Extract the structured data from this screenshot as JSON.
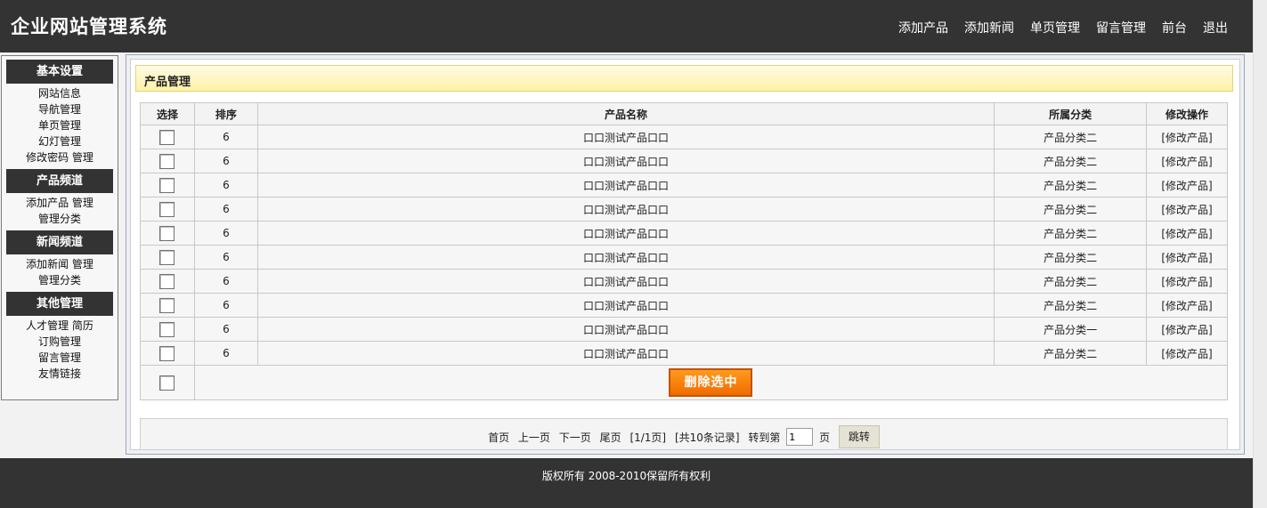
{
  "header": {
    "title": "企业网站管理系统",
    "nav": [
      "添加产品",
      "添加新闻",
      "单页管理",
      "留言管理",
      "前台",
      "退出"
    ]
  },
  "sidebar": {
    "sections": [
      {
        "heading": "基本设置",
        "items": [
          "网站信息",
          "导航管理",
          "单页管理",
          "幻灯管理",
          "修改密码 管理"
        ]
      },
      {
        "heading": "产品频道",
        "items": [
          "添加产品 管理",
          "管理分类"
        ]
      },
      {
        "heading": "新闻频道",
        "items": [
          "添加新闻 管理",
          "管理分类"
        ]
      },
      {
        "heading": "其他管理",
        "items": [
          "人才管理 简历",
          "订购管理",
          "留言管理",
          "友情链接"
        ]
      }
    ]
  },
  "main": {
    "title": "产品管理",
    "columns": [
      "选择",
      "排序",
      "产品名称",
      "所属分类",
      "修改操作"
    ],
    "rows": [
      {
        "order": "6",
        "name": "口口测试产品口口",
        "category": "产品分类二",
        "action": "[修改产品]"
      },
      {
        "order": "6",
        "name": "口口测试产品口口",
        "category": "产品分类二",
        "action": "[修改产品]"
      },
      {
        "order": "6",
        "name": "口口测试产品口口",
        "category": "产品分类二",
        "action": "[修改产品]"
      },
      {
        "order": "6",
        "name": "口口测试产品口口",
        "category": "产品分类二",
        "action": "[修改产品]"
      },
      {
        "order": "6",
        "name": "口口测试产品口口",
        "category": "产品分类二",
        "action": "[修改产品]"
      },
      {
        "order": "6",
        "name": "口口测试产品口口",
        "category": "产品分类二",
        "action": "[修改产品]"
      },
      {
        "order": "6",
        "name": "口口测试产品口口",
        "category": "产品分类二",
        "action": "[修改产品]"
      },
      {
        "order": "6",
        "name": "口口测试产品口口",
        "category": "产品分类二",
        "action": "[修改产品]"
      },
      {
        "order": "6",
        "name": "口口测试产品口口",
        "category": "产品分类一",
        "action": "[修改产品]"
      },
      {
        "order": "6",
        "name": "口口测试产品口口",
        "category": "产品分类二",
        "action": "[修改产品]"
      }
    ],
    "delete_label": "删除选中"
  },
  "pagination": {
    "first": "首页",
    "prev": "上一页",
    "next": "下一页",
    "last": "尾页",
    "page_info": "[1/1页]",
    "record_info": "[共10条记录]",
    "goto_prefix": "转到第",
    "page_value": "1",
    "goto_suffix": "页",
    "jump_label": "跳转"
  },
  "footer": {
    "copyright": "版权所有 2008-2010保留所有权利"
  }
}
